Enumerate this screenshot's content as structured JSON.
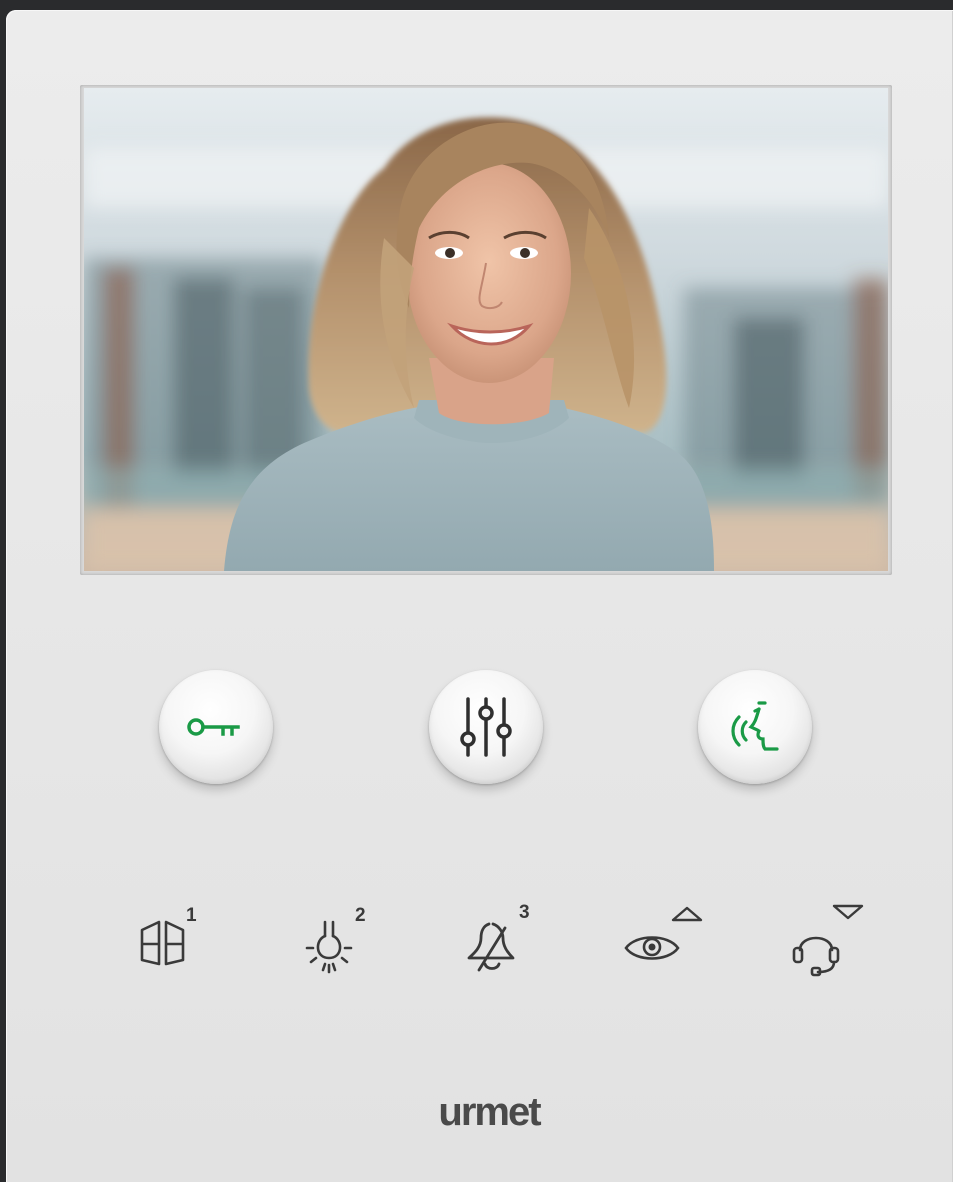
{
  "device": {
    "brand": "urmet",
    "colors": {
      "panel": "#e8e8e8",
      "accent_green": "#1a9a46",
      "icon_gray": "#3a3a3a"
    }
  },
  "main_buttons": [
    {
      "icon": "key-icon",
      "action": "door-open"
    },
    {
      "icon": "sliders-icon",
      "action": "settings"
    },
    {
      "icon": "voice-talk-icon",
      "action": "answer-call"
    }
  ],
  "function_keys": [
    {
      "icon": "door-icon",
      "number": "1"
    },
    {
      "icon": "light-bulb-icon",
      "number": "2"
    },
    {
      "icon": "mute-ringer-icon",
      "number": "3"
    },
    {
      "icon": "eye-icon",
      "arrow": "up"
    },
    {
      "icon": "headset-icon",
      "arrow": "down"
    }
  ]
}
